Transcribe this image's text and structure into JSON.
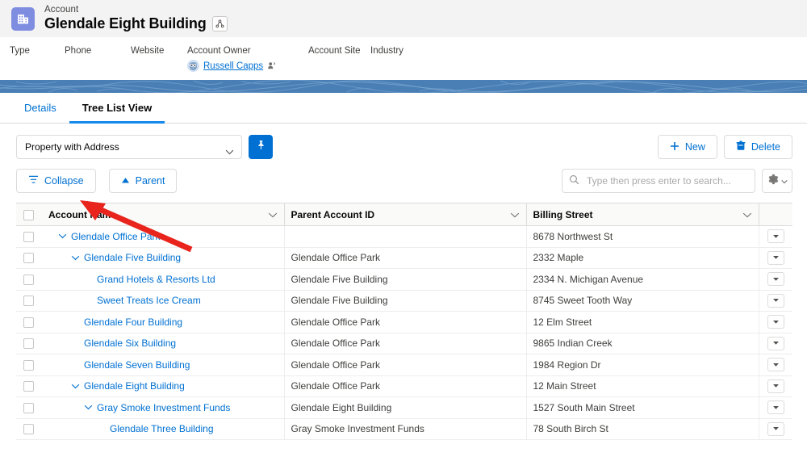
{
  "record_header": {
    "eyebrow": "Account",
    "title": "Glendale Eight Building",
    "object_icon": "account-building-icon",
    "hierarchy_icon": "hierarchy-icon"
  },
  "field_strip": {
    "fields": [
      {
        "label": "Type",
        "value": ""
      },
      {
        "label": "Phone",
        "value": ""
      },
      {
        "label": "Website",
        "value": ""
      },
      {
        "label": "Account Owner",
        "value": "Russell Capps"
      },
      {
        "label": "Account Site",
        "value": ""
      },
      {
        "label": "Industry",
        "value": ""
      }
    ],
    "owner_name": "Russell Capps"
  },
  "tabs": [
    {
      "label": "Details",
      "active": false
    },
    {
      "label": "Tree List View",
      "active": true
    }
  ],
  "toolbar": {
    "list_view_selected": "Property with Address",
    "list_view_options": [
      "Property with Address"
    ],
    "pin_label": "",
    "new_label": "New",
    "delete_label": "Delete",
    "collapse_label": "Collapse",
    "parent_label": "Parent"
  },
  "search": {
    "placeholder": "Type then press enter to search...",
    "value": ""
  },
  "table": {
    "columns": [
      "Account Name",
      "Parent Account ID",
      "Billing Street"
    ],
    "rows": [
      {
        "indent": 0,
        "expandable": true,
        "name": "Glendale Office Park",
        "parent": "",
        "street": "8678 Northwest St"
      },
      {
        "indent": 1,
        "expandable": true,
        "name": "Glendale Five Building",
        "parent": "Glendale Office Park",
        "street": "2332 Maple"
      },
      {
        "indent": 2,
        "expandable": false,
        "name": "Grand Hotels & Resorts Ltd",
        "parent": "Glendale Five Building",
        "street": "2334 N. Michigan Avenue"
      },
      {
        "indent": 2,
        "expandable": false,
        "name": "Sweet Treats Ice Cream",
        "parent": "Glendale Five Building",
        "street": "8745 Sweet Tooth Way"
      },
      {
        "indent": 1,
        "expandable": false,
        "name": "Glendale Four Building",
        "parent": "Glendale Office Park",
        "street": "12 Elm Street"
      },
      {
        "indent": 1,
        "expandable": false,
        "name": "Glendale Six Building",
        "parent": "Glendale Office Park",
        "street": "9865 Indian Creek"
      },
      {
        "indent": 1,
        "expandable": false,
        "name": "Glendale Seven Building",
        "parent": "Glendale Office Park",
        "street": "1984 Region Dr"
      },
      {
        "indent": 1,
        "expandable": true,
        "name": "Glendale Eight Building",
        "parent": "Glendale Office Park",
        "street": "12 Main Street"
      },
      {
        "indent": 2,
        "expandable": true,
        "name": "Gray Smoke Investment Funds",
        "parent": "Glendale Eight Building",
        "street": "1527 South Main Street"
      },
      {
        "indent": 3,
        "expandable": false,
        "name": "Glendale Three Building",
        "parent": "Gray Smoke Investment Funds",
        "street": "78 South Birch St"
      }
    ]
  },
  "colors": {
    "link": "#0070d2",
    "accent": "#1589ee",
    "banner": "#4a7fb5",
    "annotation": "#e8241c",
    "object_icon_bg": "#7f8de1"
  },
  "annotation": {
    "type": "arrow",
    "color": "#e8241c"
  }
}
